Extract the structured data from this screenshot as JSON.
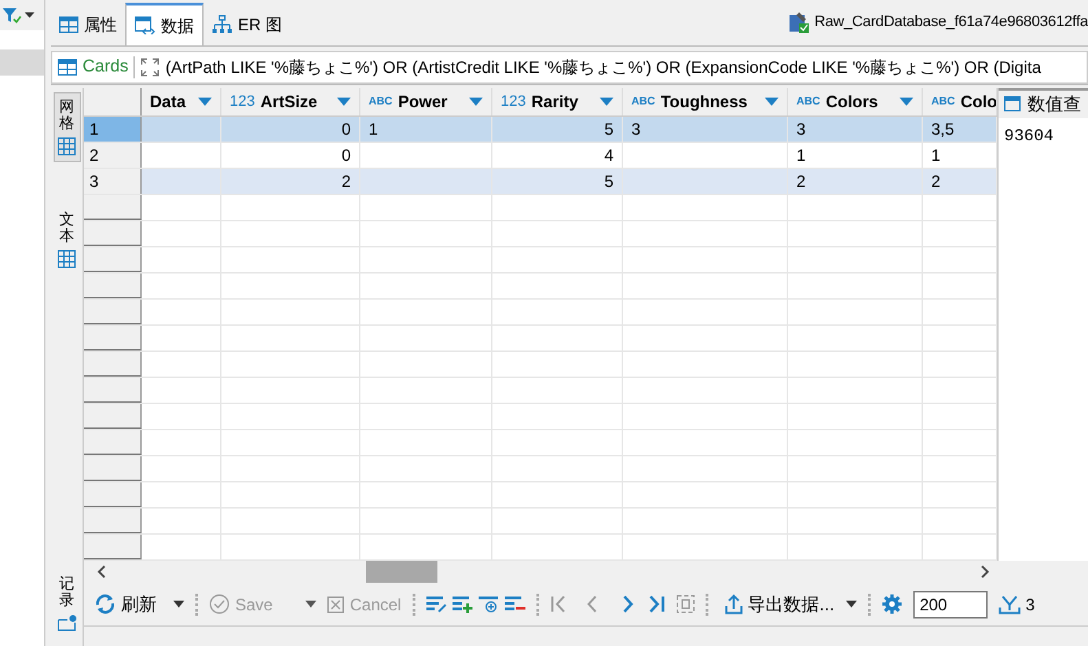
{
  "tabs": [
    {
      "label": "属性",
      "selected": false
    },
    {
      "label": "数据",
      "selected": true
    },
    {
      "label": "ER 图",
      "selected": false
    }
  ],
  "editor_title": "Raw_CardDatabase_f61a74e96803612ffa",
  "filter": {
    "table": "Cards",
    "expression": "(ArtPath LIKE '%藤ちょこ%') OR (ArtistCredit LIKE '%藤ちょこ%') OR (ExpansionCode LIKE '%藤ちょこ%') OR (Digita"
  },
  "side_tabs": [
    {
      "label": "网格",
      "selected": true
    },
    {
      "label": "文本",
      "selected": false
    }
  ],
  "record_tab": {
    "label": "记录"
  },
  "columns": [
    {
      "label": "Data",
      "kind": "text"
    },
    {
      "type": "123",
      "label": "ArtSize",
      "kind": "number"
    },
    {
      "type": "ABC",
      "label": "Power",
      "kind": "text"
    },
    {
      "type": "123",
      "label": "Rarity",
      "kind": "number"
    },
    {
      "type": "ABC",
      "label": "Toughness",
      "kind": "text"
    },
    {
      "type": "ABC",
      "label": "Colors",
      "kind": "text"
    },
    {
      "type": "ABC",
      "label": "Colo",
      "kind": "text"
    }
  ],
  "rows": [
    {
      "number": "1",
      "selected": true,
      "cells": [
        "",
        "0",
        "1",
        "5",
        "3",
        "3",
        "3,5"
      ]
    },
    {
      "number": "2",
      "selected": false,
      "cells": [
        "",
        "0",
        "",
        "4",
        "",
        "1",
        "1"
      ]
    },
    {
      "number": "3",
      "selected": false,
      "cells": [
        "",
        "2",
        "",
        "5",
        "",
        "2",
        "2"
      ]
    }
  ],
  "value_panel": {
    "title": "数值查",
    "value": "93604"
  },
  "toolbar": {
    "refresh": "刷新",
    "save": "Save",
    "save_disabled": true,
    "cancel": "Cancel",
    "cancel_disabled": true,
    "export": "导出数据...",
    "fetch_size": "200",
    "row_count": "3"
  }
}
